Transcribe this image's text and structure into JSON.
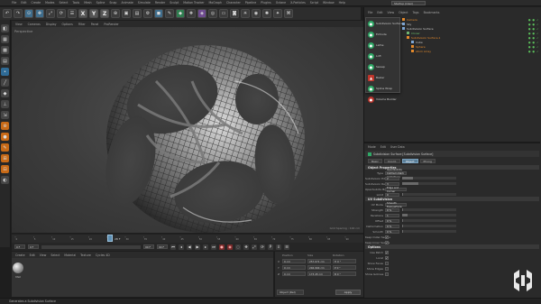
{
  "menubar": {
    "items": [
      "File",
      "Edit",
      "Create",
      "Modes",
      "Select",
      "Tools",
      "Mesh",
      "Spline",
      "Snap",
      "Animate",
      "Simulate",
      "Render",
      "Sculpt",
      "Motion Tracker",
      "MoGraph",
      "Character",
      "Pipeline",
      "Plugins",
      "Octane",
      "X-Particles",
      "Script",
      "Window",
      "Help"
    ],
    "layout_label": "Layout:",
    "layout_value": "Startup (User)"
  },
  "toolbar": {
    "axis_letters": [
      "X",
      "Y",
      "Z"
    ]
  },
  "viewport": {
    "menu": [
      "View",
      "Cameras",
      "Display",
      "Options",
      "Filter",
      "Panel",
      "ProRender"
    ],
    "label": "Perspective",
    "grid_info": "Grid Spacing : 100 cm"
  },
  "timeline": {
    "ticks": [
      "0",
      "5",
      "10",
      "15",
      "20",
      "25",
      "30",
      "35",
      "40",
      "45",
      "50",
      "55",
      "60",
      "65",
      "70",
      "75",
      "80",
      "85",
      "90"
    ],
    "current_frame_label": "28 F",
    "start_field": "0 F",
    "min_field": "0 F",
    "max_field": "90 F",
    "end_field": "90 F"
  },
  "material_manager": {
    "menu": [
      "Create",
      "Edit",
      "View",
      "Select",
      "Material",
      "Texture",
      "Cycles 4D"
    ],
    "material_name": "Mat"
  },
  "coordinates": {
    "headers": [
      "Position",
      "Size",
      "Rotation"
    ],
    "rows": [
      {
        "axis": "X",
        "pos": "0 cm",
        "size": "257.071 cm",
        "rot": "H 0 °"
      },
      {
        "axis": "Y",
        "pos": "0 cm",
        "size": "246.994 cm",
        "rot": "P 0 °"
      },
      {
        "axis": "Z",
        "pos": "0 cm",
        "size": "173.45 cm",
        "rot": "B 0 °"
      }
    ],
    "mode": "Object (Rel)",
    "apply": "Apply"
  },
  "status": "Generates a Subdivision Surface",
  "object_manager": {
    "menu": [
      "File",
      "Edit",
      "View",
      "Object",
      "Tags",
      "Bookmarks"
    ],
    "popup": [
      {
        "label": "Subdivision Surface",
        "icon": "sds-icon"
      },
      {
        "label": "Extrude",
        "icon": "extrude-icon"
      },
      {
        "label": "Lathe",
        "icon": "lathe-icon"
      },
      {
        "label": "Loft",
        "icon": "loft-icon"
      },
      {
        "label": "Sweep",
        "icon": "sweep-icon"
      },
      {
        "label": "Bezier",
        "icon": "bezier-icon"
      },
      {
        "label": "Spline Wrap",
        "icon": "spline-wrap-icon"
      },
      {
        "label": "Volume Builder",
        "icon": "volume-builder-icon"
      }
    ],
    "tree": [
      {
        "name": "Camera",
        "color": "orange",
        "indent": 0
      },
      {
        "name": "Sky",
        "color": "plain",
        "indent": 0
      },
      {
        "name": "Subdivision Surface",
        "color": "plain",
        "indent": 0
      },
      {
        "name": "Cloner",
        "color": "green",
        "indent": 1
      },
      {
        "name": "Subdivision Surface.1",
        "color": "orange",
        "indent": 1
      },
      {
        "name": "Cube",
        "color": "plain",
        "indent": 2
      },
      {
        "name": "Sphere",
        "color": "orange",
        "indent": 2
      },
      {
        "name": "Atom Array",
        "color": "orange",
        "indent": 2
      }
    ]
  },
  "attribute_manager": {
    "menu": [
      "Mode",
      "Edit",
      "User Data"
    ],
    "title": "Subdivision Surface [Subdivision Surface]",
    "tabs": [
      "Basic",
      "Coord.",
      "Object",
      "Phong"
    ],
    "active_tab": "Object",
    "section_object": "Object Properties",
    "rows": [
      {
        "k": "Type",
        "v": "OpenSubdiv Catmull-Clark (Adaptive)",
        "kind": "drop"
      },
      {
        "k": "Subdivision Editor",
        "v": "2",
        "kind": "field",
        "fill": 0.2
      },
      {
        "k": "Subdivision Renderer",
        "v": "3",
        "kind": "field",
        "fill": 0.3
      },
      {
        "k": "OpenSubdiv Boundary",
        "v": "Edge and Corner",
        "kind": "drop"
      },
      {
        "k": "Limit",
        "v": "0",
        "kind": "field",
        "fill": 0
      }
    ],
    "section_uv": "UV Subdivision",
    "uv_rows": [
      {
        "k": "UV Mode",
        "v": "Smooth Everywhere",
        "kind": "drop"
      },
      {
        "k": "Strength",
        "v": "0 %",
        "kind": "field",
        "fill": 0
      },
      {
        "k": "Iterations",
        "v": "1",
        "kind": "field",
        "fill": 0.1
      },
      {
        "k": "Offset",
        "v": "0 %",
        "kind": "field",
        "fill": 0
      },
      {
        "k": "Deformation",
        "v": "0 %",
        "kind": "field",
        "fill": 0
      },
      {
        "k": "Smooth",
        "v": "0 %",
        "kind": "field",
        "fill": 0
      }
    ],
    "checks": [
      {
        "k": "Keep Outer Seams",
        "checked": true
      },
      {
        "k": "Keep Inner Seams",
        "checked": true
      }
    ],
    "section_opt": "Options",
    "opt_rows": [
      {
        "k": "Use Patch",
        "checked": true
      },
      {
        "k": "Local",
        "checked": true
      },
      {
        "k": "Show Faces",
        "checked": false
      },
      {
        "k": "Show Edges",
        "checked": false
      },
      {
        "k": "Show Isolines",
        "checked": false
      }
    ]
  },
  "colors": {
    "accent": "#5b7f99",
    "object_orange": "#e58a2b",
    "generator_green": "#2fa866"
  }
}
